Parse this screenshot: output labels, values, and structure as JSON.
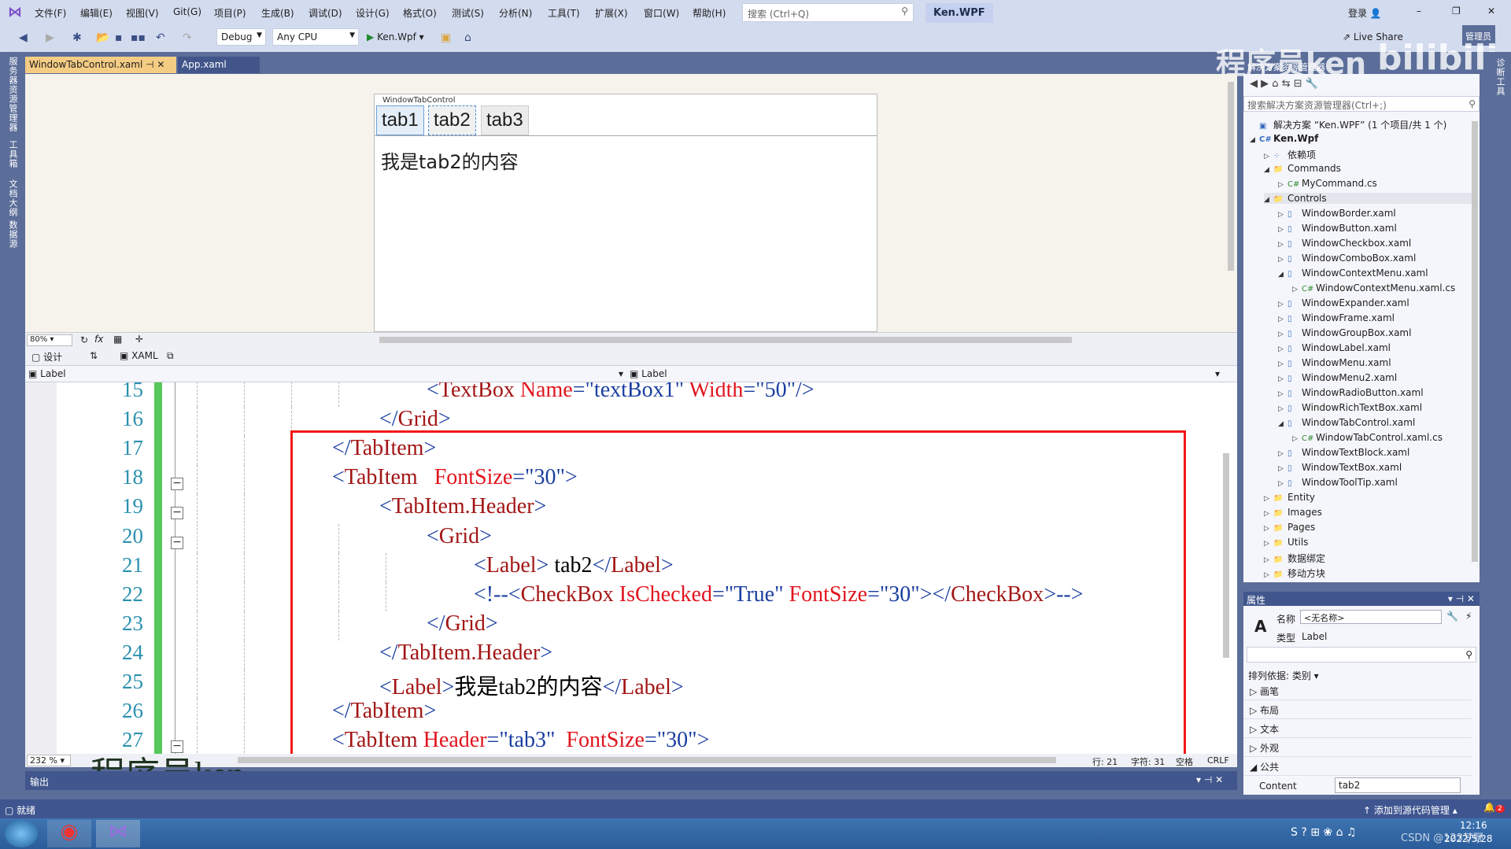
{
  "menu": {
    "items": [
      "文件(F)",
      "编辑(E)",
      "视图(V)",
      "Git(G)",
      "项目(P)",
      "生成(B)",
      "调试(D)",
      "设计(G)",
      "格式(O)",
      "测试(S)",
      "分析(N)",
      "工具(T)",
      "扩展(X)",
      "窗口(W)",
      "帮助(H)"
    ],
    "search_placeholder": "搜索 (Ctrl+Q)",
    "solution_title": "Ken.WPF",
    "login": "登录",
    "minimize": "–",
    "restore": "❐",
    "close": "✕"
  },
  "toolbar": {
    "config": "Debug",
    "platform": "Any CPU",
    "start_label": "Ken.Wpf",
    "live_share": "Live Share",
    "admin": "管理员"
  },
  "doc_tabs": [
    {
      "label": "WindowTabControl.xaml",
      "active": true
    },
    {
      "label": "App.xaml",
      "active": false
    }
  ],
  "left_strip": [
    "服务器资源管理器",
    "工具箱",
    "文档大纲",
    "数据源"
  ],
  "designer": {
    "window_title": "WindowTabControl",
    "tabs": [
      "tab1",
      "tab2",
      "tab3"
    ],
    "selected_tab": "tab2",
    "content": "我是tab2的内容",
    "zoom": "80%"
  },
  "view_tabs": {
    "design": "设计",
    "swap": "⇅",
    "xaml": "XAML"
  },
  "nav": {
    "left": "Label",
    "right": "Label"
  },
  "editor": {
    "zoom": "232 %",
    "line": "行: 21",
    "col": "字符: 31",
    "spaces": "空格",
    "eol": "CRLF",
    "lines": [
      {
        "n": "15",
        "i": 4,
        "fold": false,
        "tk": [
          [
            "delim",
            "<"
          ],
          [
            "elem",
            "TextBox"
          ],
          [
            "attr",
            " Name"
          ],
          [
            "delim",
            "="
          ],
          [
            "val",
            "\"textBox1\""
          ],
          [
            "attr",
            " Width"
          ],
          [
            "delim",
            "="
          ],
          [
            "val",
            "\"50\""
          ],
          [
            "delim",
            "/>"
          ]
        ]
      },
      {
        "n": "16",
        "i": 3,
        "fold": false,
        "tk": [
          [
            "delim",
            "</"
          ],
          [
            "elem",
            "Grid"
          ],
          [
            "delim",
            ">"
          ]
        ]
      },
      {
        "n": "17",
        "i": 2,
        "fold": false,
        "tk": [
          [
            "delim",
            "</"
          ],
          [
            "elem",
            "TabItem"
          ],
          [
            "delim",
            ">"
          ]
        ]
      },
      {
        "n": "18",
        "i": 2,
        "fold": true,
        "tk": [
          [
            "delim",
            "<"
          ],
          [
            "elem",
            "TabItem"
          ],
          [
            "attr",
            "   FontSize"
          ],
          [
            "delim",
            "="
          ],
          [
            "val",
            "\"30\""
          ],
          [
            "delim",
            ">"
          ]
        ]
      },
      {
        "n": "19",
        "i": 3,
        "fold": true,
        "tk": [
          [
            "delim",
            "<"
          ],
          [
            "elem",
            "TabItem.Header"
          ],
          [
            "delim",
            ">"
          ]
        ]
      },
      {
        "n": "20",
        "i": 4,
        "fold": true,
        "tk": [
          [
            "delim",
            "<"
          ],
          [
            "elem",
            "Grid"
          ],
          [
            "delim",
            ">"
          ]
        ]
      },
      {
        "n": "21",
        "i": 5,
        "fold": false,
        "tk": [
          [
            "delim",
            "<"
          ],
          [
            "elem",
            "Label"
          ],
          [
            "delim",
            ">"
          ],
          [
            "text",
            " tab2"
          ],
          [
            "delim",
            "</"
          ],
          [
            "elem",
            "Label"
          ],
          [
            "delim",
            ">"
          ]
        ]
      },
      {
        "n": "22",
        "i": 5,
        "fold": false,
        "tk": [
          [
            "delim",
            "<!--<"
          ],
          [
            "elem",
            "CheckBox"
          ],
          [
            "attr",
            " IsChecked"
          ],
          [
            "delim",
            "="
          ],
          [
            "val",
            "\"True\""
          ],
          [
            "attr",
            " FontSize"
          ],
          [
            "delim",
            "="
          ],
          [
            "val",
            "\"30\""
          ],
          [
            "delim",
            "></"
          ],
          [
            "elem",
            "CheckBox"
          ],
          [
            "delim",
            ">-->"
          ]
        ]
      },
      {
        "n": "23",
        "i": 4,
        "fold": false,
        "tk": [
          [
            "delim",
            "</"
          ],
          [
            "elem",
            "Grid"
          ],
          [
            "delim",
            ">"
          ]
        ]
      },
      {
        "n": "24",
        "i": 3,
        "fold": false,
        "tk": [
          [
            "delim",
            "</"
          ],
          [
            "elem",
            "TabItem.Header"
          ],
          [
            "delim",
            ">"
          ]
        ]
      },
      {
        "n": "25",
        "i": 3,
        "fold": false,
        "tk": [
          [
            "delim",
            "<"
          ],
          [
            "elem",
            "Label"
          ],
          [
            "delim",
            ">"
          ],
          [
            "text",
            "我是tab2的内容"
          ],
          [
            "delim",
            "</"
          ],
          [
            "elem",
            "Label"
          ],
          [
            "delim",
            ">"
          ]
        ]
      },
      {
        "n": "26",
        "i": 2,
        "fold": false,
        "tk": [
          [
            "delim",
            "</"
          ],
          [
            "elem",
            "TabItem"
          ],
          [
            "delim",
            ">"
          ]
        ]
      },
      {
        "n": "27",
        "i": 2,
        "fold": true,
        "tk": [
          [
            "delim",
            "<"
          ],
          [
            "elem",
            "TabItem"
          ],
          [
            "attr",
            " Header"
          ],
          [
            "delim",
            "="
          ],
          [
            "val",
            "\"tab3\""
          ],
          [
            "attr",
            "  FontSize"
          ],
          [
            "delim",
            "="
          ],
          [
            "val",
            "\"30\""
          ],
          [
            "delim",
            ">"
          ]
        ]
      }
    ]
  },
  "output": {
    "title": "输出"
  },
  "status": {
    "ready": "就绪",
    "source_control": "添加到源代码管理",
    "notifications": "2"
  },
  "solution_explorer": {
    "title": "解决方案资源管理器",
    "search_placeholder": "搜索解决方案资源管理器(Ctrl+;)",
    "items": [
      {
        "label": "解决方案 “Ken.WPF” (1 个项目/共 1 个)",
        "d": 0,
        "e": "",
        "icon": "solution-icon"
      },
      {
        "label": "Ken.Wpf",
        "d": 0,
        "e": "◢",
        "icon": "csproj-icon",
        "bold": true
      },
      {
        "label": "依赖项",
        "d": 1,
        "e": "▷",
        "icon": "dependencies-icon"
      },
      {
        "label": "Commands",
        "d": 1,
        "e": "◢",
        "icon": "folder-icon"
      },
      {
        "label": "MyCommand.cs",
        "d": 2,
        "e": "▷",
        "icon": "csharp-file-icon"
      },
      {
        "label": "Controls",
        "d": 1,
        "e": "◢",
        "icon": "folder-icon",
        "sel": true
      },
      {
        "label": "WindowBorder.xaml",
        "d": 2,
        "e": "▷",
        "icon": "xaml-file-icon"
      },
      {
        "label": "WindowButton.xaml",
        "d": 2,
        "e": "▷",
        "icon": "xaml-file-icon"
      },
      {
        "label": "WindowCheckbox.xaml",
        "d": 2,
        "e": "▷",
        "icon": "xaml-file-icon"
      },
      {
        "label": "WindowComboBox.xaml",
        "d": 2,
        "e": "▷",
        "icon": "xaml-file-icon"
      },
      {
        "label": "WindowContextMenu.xaml",
        "d": 2,
        "e": "◢",
        "icon": "xaml-file-icon"
      },
      {
        "label": "WindowContextMenu.xaml.cs",
        "d": 3,
        "e": "▷",
        "icon": "csharp-file-icon"
      },
      {
        "label": "WindowExpander.xaml",
        "d": 2,
        "e": "▷",
        "icon": "xaml-file-icon"
      },
      {
        "label": "WindowFrame.xaml",
        "d": 2,
        "e": "▷",
        "icon": "xaml-file-icon"
      },
      {
        "label": "WindowGroupBox.xaml",
        "d": 2,
        "e": "▷",
        "icon": "xaml-file-icon"
      },
      {
        "label": "WindowLabel.xaml",
        "d": 2,
        "e": "▷",
        "icon": "xaml-file-icon"
      },
      {
        "label": "WindowMenu.xaml",
        "d": 2,
        "e": "▷",
        "icon": "xaml-file-icon"
      },
      {
        "label": "WindowMenu2.xaml",
        "d": 2,
        "e": "▷",
        "icon": "xaml-file-icon"
      },
      {
        "label": "WindowRadioButton.xaml",
        "d": 2,
        "e": "▷",
        "icon": "xaml-file-icon"
      },
      {
        "label": "WindowRichTextBox.xaml",
        "d": 2,
        "e": "▷",
        "icon": "xaml-file-icon"
      },
      {
        "label": "WindowTabControl.xaml",
        "d": 2,
        "e": "◢",
        "icon": "xaml-file-icon"
      },
      {
        "label": "WindowTabControl.xaml.cs",
        "d": 3,
        "e": "▷",
        "icon": "csharp-file-icon"
      },
      {
        "label": "WindowTextBlock.xaml",
        "d": 2,
        "e": "▷",
        "icon": "xaml-file-icon"
      },
      {
        "label": "WindowTextBox.xaml",
        "d": 2,
        "e": "▷",
        "icon": "xaml-file-icon"
      },
      {
        "label": "WindowToolTip.xaml",
        "d": 2,
        "e": "▷",
        "icon": "xaml-file-icon"
      },
      {
        "label": "Entity",
        "d": 1,
        "e": "▷",
        "icon": "folder-icon"
      },
      {
        "label": "Images",
        "d": 1,
        "e": "▷",
        "icon": "folder-icon"
      },
      {
        "label": "Pages",
        "d": 1,
        "e": "▷",
        "icon": "folder-icon"
      },
      {
        "label": "Utils",
        "d": 1,
        "e": "▷",
        "icon": "folder-icon"
      },
      {
        "label": "数据绑定",
        "d": 1,
        "e": "▷",
        "icon": "folder-icon"
      },
      {
        "label": "移动方块",
        "d": 1,
        "e": "▷",
        "icon": "folder-icon"
      }
    ]
  },
  "properties": {
    "title": "属性",
    "name_label": "名称",
    "name_value": "<无名称>",
    "type_label": "类型",
    "type_value": "Label",
    "sort": "排列依据: 类别 ▾",
    "categories": [
      {
        "label": "画笔",
        "open": false
      },
      {
        "label": "布局",
        "open": false
      },
      {
        "label": "文本",
        "open": false
      },
      {
        "label": "外观",
        "open": false
      },
      {
        "label": "公共",
        "open": true
      }
    ],
    "content_label": "Content",
    "content_value": "tab2"
  },
  "right_strip": "诊断工具",
  "watermarks": {
    "top": "程序员ken",
    "overlay": "程序员ken",
    "csdn": "CSDN @123梦野"
  },
  "tray": {
    "time": "12:16",
    "date": "2022/5/28"
  },
  "colors": {
    "accent": "#5b6d99",
    "menu_bg": "#d3dbee",
    "highlight_box": "#f21818",
    "tab_active": "#f5cc84"
  }
}
